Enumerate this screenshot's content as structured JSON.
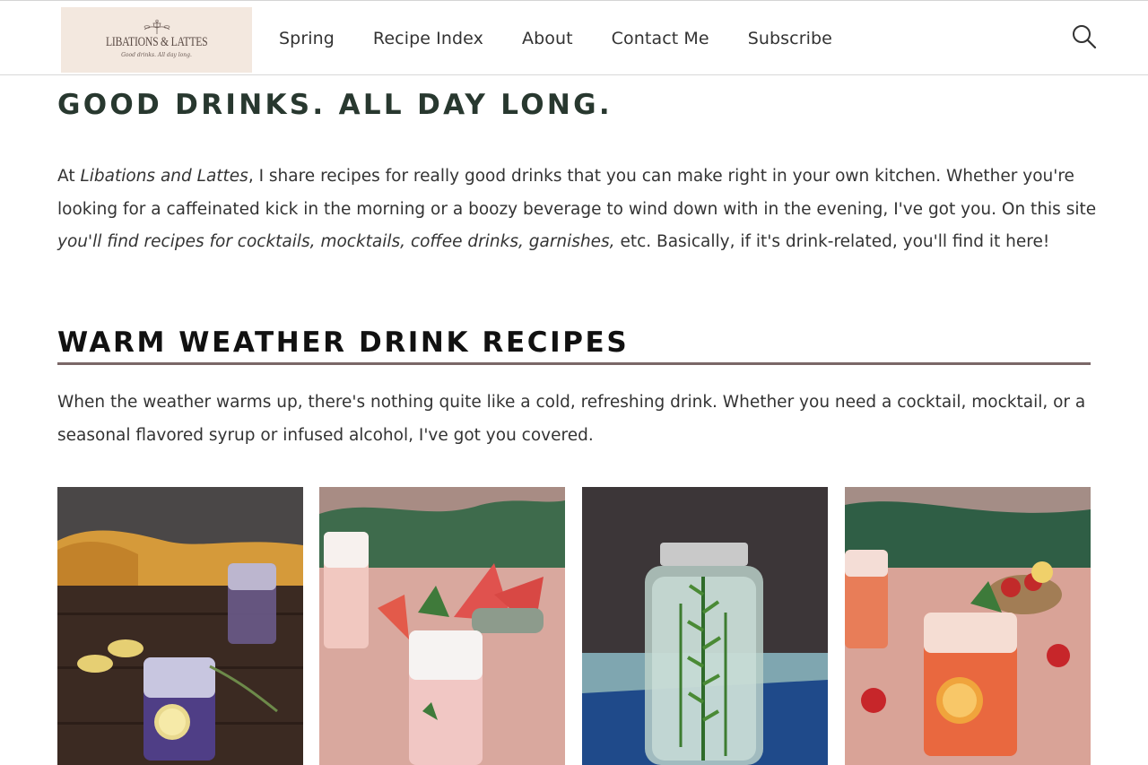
{
  "header": {
    "logo": {
      "title": "LIBATIONS & LATTES",
      "tagline": "Good drinks. All day long."
    },
    "nav": [
      "Spring",
      "Recipe Index",
      "About",
      "Contact Me",
      "Subscribe"
    ],
    "search_icon": "search-icon"
  },
  "main": {
    "title": "GOOD DRINKS. ALL DAY LONG.",
    "intro": {
      "p1": "At ",
      "brand": "Libations and Lattes",
      "p2": ", I share recipes for really good drinks that you can make right in your own kitchen. Whether you're looking for a caffeinated kick in the morning or a boozy beverage to wind down with in the evening, I've got you. On this site ",
      "emph": "you'll find recipes for cocktails, mocktails, coffee drinks, garnishes,",
      "p3": " etc. Basically, if it's drink-related, you'll find it here!"
    },
    "section_title": "WARM WEATHER DRINK RECIPES",
    "section_text": "When the weather warms up, there's nothing quite like a cold, refreshing drink. Whether you need a cocktail, mocktail, or a seasonal flavored syrup or infused alcohol, I've got you covered."
  },
  "colors": {
    "heading": "#28382f",
    "rule": "#7a6767",
    "logo_bg": "#f3e8df"
  }
}
